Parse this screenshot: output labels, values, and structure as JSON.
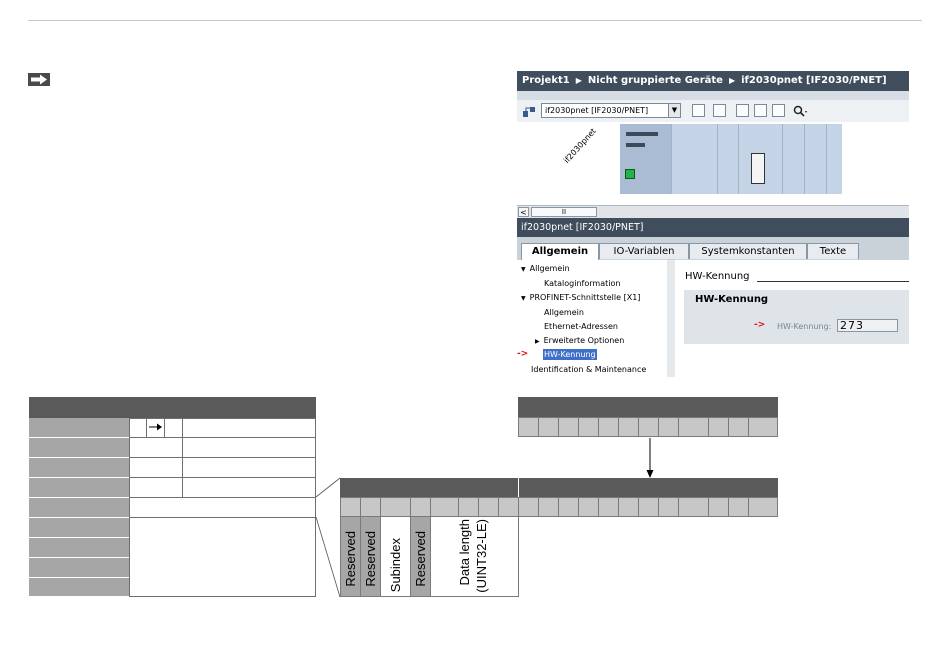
{
  "tia": {
    "breadcrumb": [
      "Projekt1",
      "Nicht gruppierte Geräte",
      "if2030pnet [IF2030/PNET]"
    ],
    "device_select": "if2030pnet [IF2030/PNET]",
    "device_label": "if2030pnet",
    "scroll_thumb": "II",
    "inspector_title": "if2030pnet [IF2030/PNET]",
    "tabs": [
      "Allgemein",
      "IO-Variablen",
      "Systemkonstanten",
      "Texte"
    ],
    "tree": [
      {
        "label": "Allgemein",
        "expanded": true
      },
      {
        "label": "Kataloginformation"
      },
      {
        "label": "PROFINET-Schnittstelle [X1]",
        "expanded": true
      },
      {
        "label": "Allgemein"
      },
      {
        "label": "Ethernet-Adressen"
      },
      {
        "label": "Erweiterte Optionen",
        "collapsed": true
      },
      {
        "label": "HW-Kennung",
        "selected": true
      },
      {
        "label": "Identification & Maintenance"
      }
    ],
    "prop_header": "HW-Kennung",
    "prop_box_title": "HW-Kennung",
    "prop_field_label": "HW-Kennung:",
    "prop_field_value": "273"
  },
  "fields": {
    "reserved1": "Reserved",
    "reserved2": "Reserved",
    "subindex": "Subindex",
    "reserved3": "Reserved",
    "data_length": "Data length",
    "data_length_type": "(UINT32-LE)"
  },
  "colors": {
    "header_dark": "#3f4d5c",
    "table_head": "#5a5a5a",
    "table_grey": "#a6a6a6",
    "bit_cell": "#c7c7c7",
    "selection": "#3e70c8",
    "marker_red": "#e01010"
  }
}
